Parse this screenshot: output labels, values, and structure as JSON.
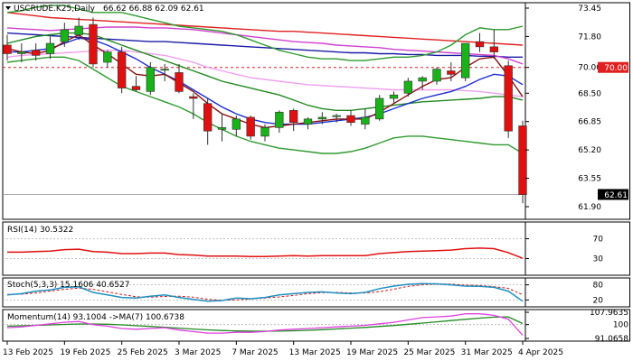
{
  "chart_data": {
    "type": "candlestick",
    "symbol_header": "USCRUDE.K25,Daily",
    "ohlc_header": "66.62 66.88 62.09 62.61",
    "title": "",
    "price_axis": {
      "range": [
        61.9,
        73.45
      ],
      "ticks": [
        "73.45",
        "71.80",
        "70.00",
        "68.50",
        "66.85",
        "65.20",
        "63.55",
        "61.90"
      ],
      "tick_values": [
        73.45,
        71.8,
        70.0,
        68.5,
        66.85,
        65.2,
        63.55,
        61.9
      ],
      "current_price_label": "62.61",
      "current_price": 62.61,
      "level_label": "70.00",
      "level_value": 70.0
    },
    "x_labels": [
      {
        "text": "13 Feb 2025",
        "index": 0
      },
      {
        "text": "19 Feb 2025",
        "index": 4
      },
      {
        "text": "25 Feb 2025",
        "index": 8
      },
      {
        "text": "3 Mar 2025",
        "index": 12
      },
      {
        "text": "7 Mar 2025",
        "index": 16
      },
      {
        "text": "13 Mar 2025",
        "index": 20
      },
      {
        "text": "19 Mar 2025",
        "index": 24
      },
      {
        "text": "25 Mar 2025",
        "index": 28
      },
      {
        "text": "31 Mar 2025",
        "index": 32
      },
      {
        "text": "4 Apr 2025",
        "index": 36
      }
    ],
    "candles": [
      {
        "o": 71.3,
        "h": 71.9,
        "l": 70.4,
        "c": 70.8
      },
      {
        "o": 70.8,
        "h": 71.4,
        "l": 70.3,
        "c": 70.9
      },
      {
        "o": 71.0,
        "h": 71.4,
        "l": 70.4,
        "c": 70.7
      },
      {
        "o": 70.8,
        "h": 71.8,
        "l": 70.5,
        "c": 71.4
      },
      {
        "o": 71.5,
        "h": 72.6,
        "l": 71.2,
        "c": 72.2
      },
      {
        "o": 71.9,
        "h": 72.9,
        "l": 71.6,
        "c": 72.4
      },
      {
        "o": 72.5,
        "h": 72.9,
        "l": 70.0,
        "c": 70.2
      },
      {
        "o": 70.3,
        "h": 71.0,
        "l": 70.0,
        "c": 70.9
      },
      {
        "o": 70.9,
        "h": 71.2,
        "l": 68.5,
        "c": 68.8
      },
      {
        "o": 68.9,
        "h": 69.5,
        "l": 68.6,
        "c": 68.7
      },
      {
        "o": 68.6,
        "h": 70.3,
        "l": 68.4,
        "c": 70.0
      },
      {
        "o": 69.9,
        "h": 70.2,
        "l": 69.2,
        "c": 69.9
      },
      {
        "o": 69.7,
        "h": 70.2,
        "l": 68.5,
        "c": 68.6
      },
      {
        "o": 68.3,
        "h": 68.5,
        "l": 67.0,
        "c": 68.2
      },
      {
        "o": 67.9,
        "h": 68.2,
        "l": 65.5,
        "c": 66.3
      },
      {
        "o": 66.4,
        "h": 67.3,
        "l": 65.7,
        "c": 66.5
      },
      {
        "o": 66.4,
        "h": 67.2,
        "l": 66.0,
        "c": 67.0
      },
      {
        "o": 67.1,
        "h": 67.2,
        "l": 65.8,
        "c": 66.0
      },
      {
        "o": 66.0,
        "h": 66.7,
        "l": 65.7,
        "c": 66.5
      },
      {
        "o": 66.5,
        "h": 67.5,
        "l": 66.2,
        "c": 67.4
      },
      {
        "o": 67.5,
        "h": 67.6,
        "l": 66.3,
        "c": 66.8
      },
      {
        "o": 66.7,
        "h": 67.1,
        "l": 66.4,
        "c": 67.0
      },
      {
        "o": 67.0,
        "h": 67.4,
        "l": 66.7,
        "c": 67.1
      },
      {
        "o": 67.2,
        "h": 67.3,
        "l": 66.8,
        "c": 67.2
      },
      {
        "o": 67.2,
        "h": 67.5,
        "l": 66.6,
        "c": 66.8
      },
      {
        "o": 66.7,
        "h": 67.6,
        "l": 66.4,
        "c": 67.1
      },
      {
        "o": 67.0,
        "h": 68.4,
        "l": 66.9,
        "c": 68.2
      },
      {
        "o": 68.2,
        "h": 68.6,
        "l": 67.9,
        "c": 68.4
      },
      {
        "o": 68.5,
        "h": 69.4,
        "l": 68.3,
        "c": 69.2
      },
      {
        "o": 69.2,
        "h": 69.5,
        "l": 68.7,
        "c": 69.4
      },
      {
        "o": 69.2,
        "h": 70.0,
        "l": 69.0,
        "c": 69.9
      },
      {
        "o": 69.8,
        "h": 70.3,
        "l": 69.2,
        "c": 69.6
      },
      {
        "o": 69.4,
        "h": 71.3,
        "l": 69.2,
        "c": 71.4
      },
      {
        "o": 71.5,
        "h": 72.0,
        "l": 70.9,
        "c": 71.2
      },
      {
        "o": 71.2,
        "h": 72.2,
        "l": 70.5,
        "c": 70.9
      },
      {
        "o": 70.1,
        "h": 70.4,
        "l": 65.9,
        "c": 66.3
      },
      {
        "o": 66.6,
        "h": 66.9,
        "l": 62.1,
        "c": 62.6
      }
    ],
    "overlays": [
      {
        "name": "",
        "color": "#e02020",
        "values": [
          73.2,
          73.1,
          73.0,
          72.9,
          72.85,
          72.8,
          72.75,
          72.7,
          72.65,
          72.6,
          72.55,
          72.5,
          72.45,
          72.4,
          72.35,
          72.3,
          72.25,
          72.2,
          72.15,
          72.1,
          72.1,
          72.05,
          72.0,
          71.95,
          71.9,
          71.85,
          71.8,
          71.75,
          71.7,
          71.65,
          71.6,
          71.55,
          71.5,
          71.45,
          71.4,
          71.35,
          71.3
        ]
      },
      {
        "name": "",
        "color": "#1a1aa8",
        "values": [
          72.0,
          71.95,
          71.9,
          71.85,
          71.8,
          71.75,
          71.7,
          71.65,
          71.6,
          71.55,
          71.5,
          71.5,
          71.45,
          71.4,
          71.35,
          71.3,
          71.25,
          71.2,
          71.15,
          71.1,
          71.05,
          71.0,
          70.95,
          70.9,
          70.85,
          70.85,
          70.8,
          70.8,
          70.75,
          70.75,
          70.7,
          70.7,
          70.7,
          70.65,
          70.65,
          70.6,
          70.6
        ]
      },
      {
        "name": "",
        "color": "#d040d0",
        "values": [
          72.3,
          72.25,
          72.2,
          72.15,
          72.2,
          72.25,
          72.3,
          72.35,
          72.35,
          72.35,
          72.3,
          72.3,
          72.25,
          72.2,
          72.1,
          72.0,
          71.9,
          71.8,
          71.7,
          71.6,
          71.5,
          71.45,
          71.4,
          71.3,
          71.25,
          71.2,
          71.15,
          71.05,
          71.0,
          70.95,
          70.9,
          70.85,
          70.8,
          70.75,
          70.7,
          70.5,
          70.2
        ]
      },
      {
        "name": "",
        "color": "#f0a0f0",
        "values": [
          70.6,
          70.7,
          70.75,
          70.8,
          70.85,
          70.9,
          70.95,
          71.0,
          71.0,
          70.9,
          70.8,
          70.7,
          70.5,
          70.3,
          70.0,
          69.8,
          69.6,
          69.4,
          69.3,
          69.2,
          69.1,
          69.0,
          68.95,
          68.9,
          68.85,
          68.8,
          68.75,
          68.7,
          68.7,
          68.7,
          68.7,
          68.7,
          68.65,
          68.6,
          68.5,
          68.4,
          68.3
        ]
      },
      {
        "name": "",
        "color": "#208a20",
        "values": [
          71.4,
          71.6,
          71.8,
          71.9,
          72.0,
          72.0,
          71.9,
          71.6,
          71.3,
          71.0,
          70.7,
          70.4,
          70.1,
          69.8,
          69.5,
          69.2,
          69.0,
          68.8,
          68.6,
          68.4,
          68.1,
          67.8,
          67.6,
          67.5,
          67.5,
          67.6,
          67.7,
          67.8,
          67.9,
          68.0,
          68.05,
          68.1,
          68.15,
          68.2,
          68.3,
          68.3,
          68.1
        ]
      },
      {
        "name": "",
        "color": "#1d2fd0",
        "values": [
          70.9,
          70.9,
          71.0,
          71.1,
          71.4,
          71.7,
          71.6,
          71.3,
          70.9,
          70.5,
          70.0,
          69.6,
          69.2,
          68.7,
          68.2,
          67.7,
          67.3,
          67.0,
          66.8,
          66.7,
          66.7,
          66.7,
          66.8,
          66.9,
          67.0,
          67.1,
          67.3,
          67.6,
          67.9,
          68.2,
          68.4,
          68.6,
          68.9,
          69.3,
          69.6,
          69.5,
          69.0
        ]
      },
      {
        "name": "",
        "color": "#8b1010",
        "values": [
          71.1,
          70.9,
          70.8,
          71.0,
          71.5,
          71.9,
          71.3,
          70.8,
          70.2,
          69.6,
          69.5,
          69.6,
          69.1,
          68.6,
          67.9,
          67.3,
          67.0,
          66.7,
          66.5,
          66.6,
          66.7,
          66.8,
          66.9,
          67.0,
          67.0,
          67.0,
          67.4,
          67.9,
          68.4,
          68.9,
          69.3,
          69.4,
          70.0,
          70.5,
          70.6,
          69.5,
          68.3
        ]
      },
      {
        "name": "",
        "color": "#2e9a2e",
        "values": [
          70.3,
          70.4,
          70.5,
          70.6,
          70.6,
          70.4,
          69.9,
          69.4,
          68.9,
          68.6,
          68.3,
          68.0,
          67.7,
          67.3,
          66.8,
          66.4,
          66.0,
          65.7,
          65.5,
          65.3,
          65.2,
          65.1,
          65.0,
          65.0,
          65.1,
          65.3,
          65.6,
          65.9,
          66.0,
          66.0,
          65.9,
          65.8,
          65.7,
          65.6,
          65.5,
          65.5,
          65.0
        ]
      },
      {
        "name": "",
        "color": "#2e9a2e",
        "values": [
          73.2,
          73.3,
          73.5,
          73.6,
          73.6,
          73.4,
          73.2,
          73.2,
          73.2,
          73.0,
          72.8,
          72.6,
          72.4,
          72.3,
          72.2,
          72.1,
          71.9,
          71.6,
          71.3,
          71.0,
          70.8,
          70.6,
          70.5,
          70.5,
          70.4,
          70.4,
          70.5,
          70.6,
          70.6,
          70.7,
          70.9,
          71.3,
          71.9,
          72.3,
          72.2,
          72.2,
          72.4
        ]
      }
    ],
    "rsi": {
      "header": "RSI(14) 30.5322",
      "ticks": [
        "70",
        "30"
      ],
      "tick_values": [
        70,
        30
      ],
      "range": [
        0,
        100
      ],
      "levels": [
        70,
        30
      ],
      "color": "#e01010",
      "values": [
        43,
        43,
        44,
        45,
        48,
        49,
        44,
        43,
        40,
        40,
        41,
        41,
        38,
        37,
        35,
        35,
        35,
        34,
        34,
        35,
        36,
        35,
        36,
        36,
        36,
        36,
        40,
        42,
        44,
        45,
        46,
        47,
        50,
        51,
        50,
        42,
        30.5
      ]
    },
    "stoch": {
      "header": "Stoch(5,3,3) 15.1606 40.6527",
      "ticks": [
        "80",
        "20"
      ],
      "tick_values": [
        80,
        20
      ],
      "range": [
        0,
        100
      ],
      "levels": [
        80,
        20
      ],
      "k_color": "#1e90c0",
      "d_color": "#d02020",
      "k_values": [
        40,
        45,
        55,
        60,
        70,
        72,
        50,
        40,
        30,
        28,
        35,
        40,
        30,
        22,
        15,
        18,
        28,
        25,
        30,
        40,
        45,
        50,
        52,
        48,
        45,
        50,
        65,
        75,
        82,
        85,
        84,
        80,
        75,
        74,
        70,
        55,
        15.16
      ],
      "d_values": [
        42,
        43,
        48,
        55,
        62,
        67,
        62,
        52,
        42,
        33,
        31,
        34,
        35,
        31,
        23,
        19,
        20,
        24,
        28,
        32,
        38,
        45,
        49,
        50,
        48,
        48,
        53,
        63,
        74,
        80,
        83,
        83,
        79,
        77,
        73,
        66,
        40.65
      ]
    },
    "momentum": {
      "header": "Momentum(14) 93.1004  ->MA(7) 100.6738",
      "ticks": [
        "107.9635",
        "100",
        "91.0658"
      ],
      "tick_values": [
        107.9635,
        100,
        91.0658
      ],
      "range": [
        91.0658,
        107.9635
      ],
      "level": 100,
      "color": "#e040e0",
      "ma_color": "#208a20",
      "values": [
        98.0,
        98.5,
        99.5,
        100.5,
        101.5,
        102.0,
        100.0,
        99.0,
        97.5,
        97.0,
        97.5,
        98.0,
        96.5,
        95.5,
        94.5,
        94.5,
        95.0,
        95.0,
        95.5,
        96.5,
        97.0,
        97.5,
        98.0,
        98.5,
        99.0,
        99.5,
        100.5,
        101.5,
        103.0,
        104.5,
        105.0,
        105.5,
        107.0,
        107.0,
        106.0,
        103.5,
        93.1
      ],
      "ma_values": [
        99.0,
        99.2,
        99.5,
        99.8,
        100.1,
        100.4,
        100.4,
        100.2,
        99.8,
        99.3,
        98.8,
        98.3,
        97.7,
        97.1,
        96.6,
        96.2,
        95.9,
        95.8,
        95.7,
        95.8,
        96.0,
        96.3,
        96.7,
        97.2,
        97.7,
        98.2,
        98.8,
        99.4,
        100.2,
        101.0,
        101.8,
        102.6,
        103.4,
        104.2,
        104.8,
        105.0,
        100.67
      ]
    }
  }
}
